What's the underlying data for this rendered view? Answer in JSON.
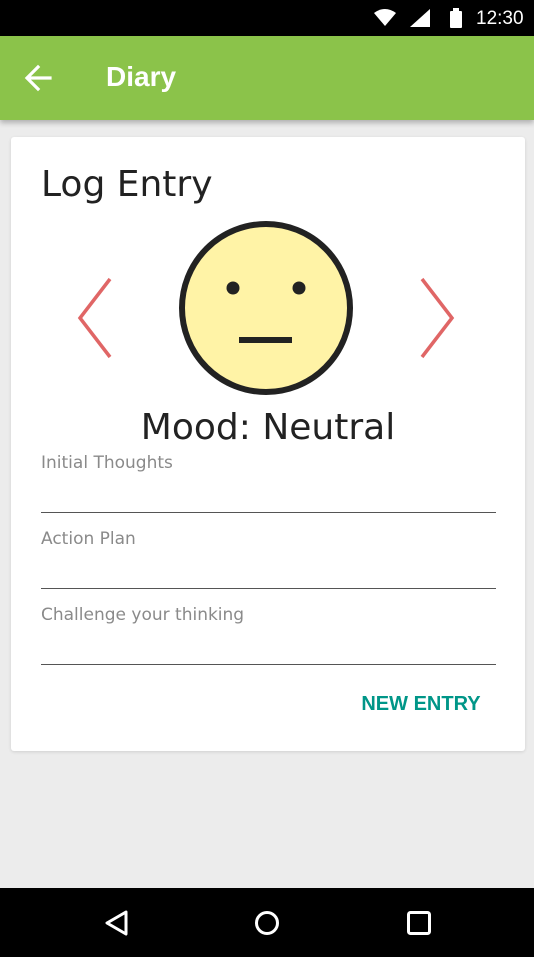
{
  "status_bar": {
    "time": "12:30",
    "icons": [
      "wifi-icon",
      "signal-icon",
      "battery-icon"
    ]
  },
  "app_bar": {
    "title": "Diary",
    "back_icon": "arrow-left-icon",
    "background_color": "#8bc34a"
  },
  "card": {
    "title": "Log Entry",
    "mood_label": "Mood: Neutral",
    "prev_icon": "chevron-left-icon",
    "next_icon": "chevron-right-icon",
    "arrow_color": "#e06666",
    "face_icon": "neutral-face-icon",
    "face_color": "#fff3a6",
    "fields": [
      {
        "placeholder": "Initial Thoughts",
        "value": ""
      },
      {
        "placeholder": "Action Plan",
        "value": ""
      },
      {
        "placeholder": "Challenge your thinking",
        "value": ""
      }
    ],
    "action_button": "NEW ENTRY",
    "action_color": "#009688"
  },
  "nav_bar": {
    "icons": [
      "back-triangle-icon",
      "home-circle-icon",
      "recents-square-icon"
    ]
  }
}
